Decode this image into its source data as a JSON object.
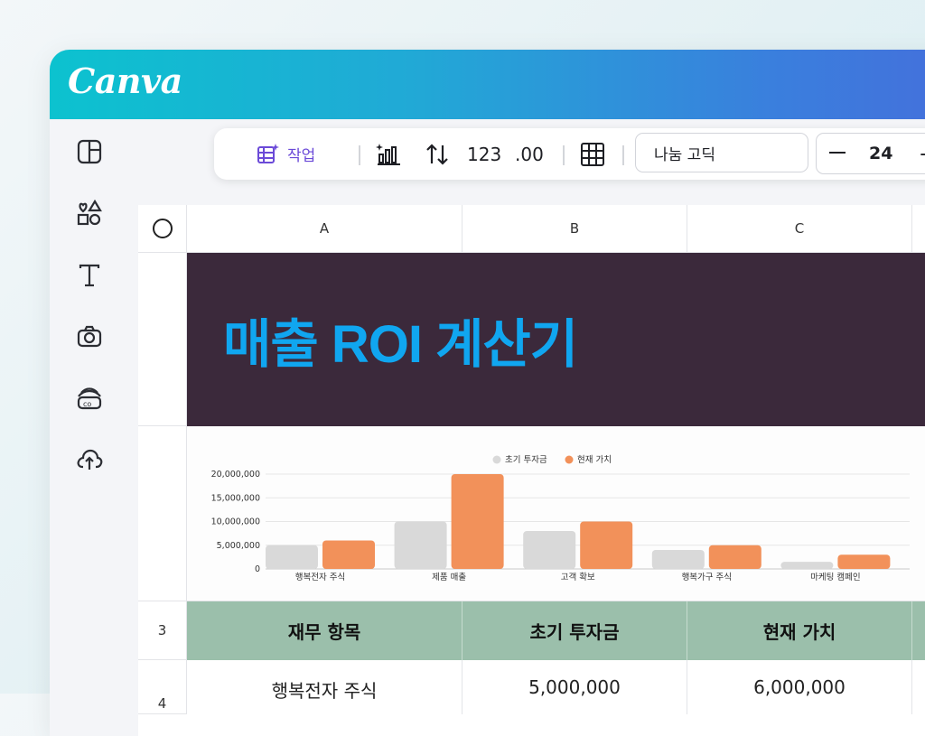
{
  "app": {
    "logo": "Canva"
  },
  "toolbar": {
    "action_label": "작업",
    "number_format": "123",
    "decimal_format": ".00",
    "font_name": "나눔 고딕",
    "font_size": "24",
    "icons": [
      "magic-grid-icon",
      "chart-icon",
      "sort-icon",
      "table-icon"
    ]
  },
  "sidebar": {
    "icons": [
      "layout-icon",
      "elements-icon",
      "text-icon",
      "camera-icon",
      "brand-icon",
      "upload-icon"
    ]
  },
  "sheet": {
    "columns": [
      "A",
      "B",
      "C"
    ],
    "row_numbers": [
      "3",
      "4"
    ],
    "title": "매출 ROI 계산기",
    "headers": [
      "재무 항목",
      "초기 투자금",
      "현재 가치"
    ],
    "first_row": [
      "행복전자 주식",
      "5,000,000",
      "6,000,000"
    ]
  },
  "colors": {
    "title_bg": "#3b293b",
    "title_text": "#10a6f0",
    "header_bg": "#9bbfab",
    "series_initial": "#d9d9d9",
    "series_current": "#f2915a"
  },
  "chart_data": {
    "type": "bar",
    "categories": [
      "행복전자 주식",
      "제품 매출",
      "고객 확보",
      "행복가구 주식",
      "마케팅 캠페인"
    ],
    "series": [
      {
        "name": "초기 투자금",
        "color": "#d9d9d9",
        "values": [
          5000000,
          10000000,
          8000000,
          4000000,
          1500000
        ]
      },
      {
        "name": "현재 가치",
        "color": "#f2915a",
        "values": [
          6000000,
          20000000,
          10000000,
          5000000,
          3000000
        ]
      }
    ],
    "yticks": [
      "0",
      "5,000,000",
      "10,000,000",
      "15,000,000",
      "20,000,000"
    ],
    "ylim": [
      0,
      20000000
    ],
    "legend": "top-center",
    "grid": true
  }
}
